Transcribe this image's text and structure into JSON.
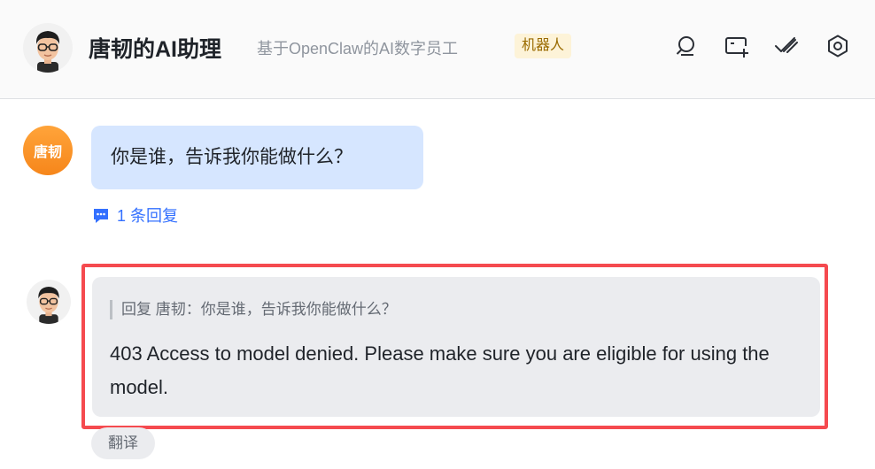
{
  "header": {
    "title": "唐韧的AI助理",
    "subtitle": "基于OpenClaw的AI数字员工",
    "tag": "机器人",
    "icons": [
      "search-icon",
      "new-message-icon",
      "task-check-icon",
      "settings-icon"
    ]
  },
  "messages": [
    {
      "sender_avatar_text": "唐韧",
      "text": "你是谁，告诉我你能做什么？",
      "reply_count_label": "1 条回复"
    },
    {
      "quote": "回复 唐韧：你是谁，告诉我你能做什么？",
      "text": "403 Access to model denied. Please make sure you are eligible for using the model.",
      "translate_label": "翻译"
    }
  ],
  "colors": {
    "accent": "#3370ff",
    "highlight_frame": "#f54a4f",
    "user_bubble": "#d6e6ff",
    "bot_bubble": "#ebecef",
    "user_avatar": "#f6861b"
  }
}
